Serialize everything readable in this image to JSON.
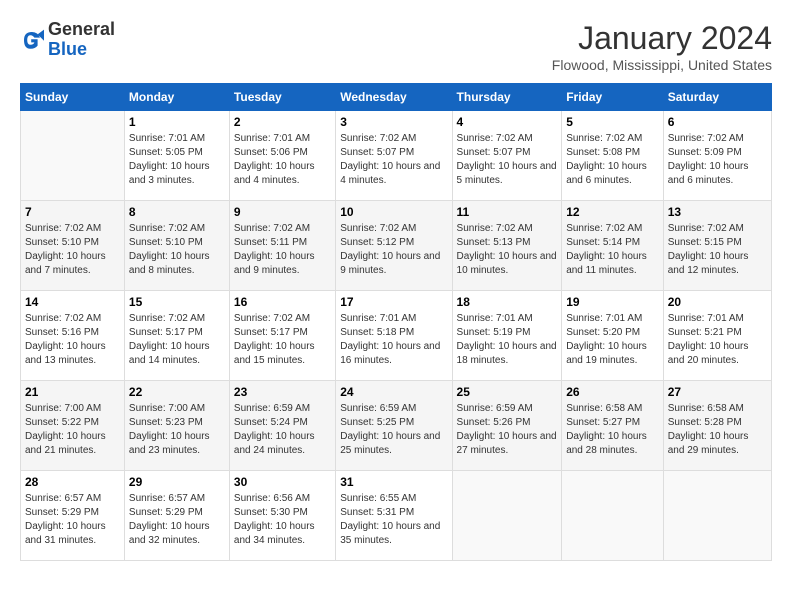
{
  "header": {
    "logo": {
      "line1": "General",
      "line2": "Blue"
    },
    "title": "January 2024",
    "location": "Flowood, Mississippi, United States"
  },
  "calendar": {
    "headers": [
      "Sunday",
      "Monday",
      "Tuesday",
      "Wednesday",
      "Thursday",
      "Friday",
      "Saturday"
    ],
    "weeks": [
      [
        {
          "day": "",
          "sunrise": "",
          "sunset": "",
          "daylight": ""
        },
        {
          "day": "1",
          "sunrise": "Sunrise: 7:01 AM",
          "sunset": "Sunset: 5:05 PM",
          "daylight": "Daylight: 10 hours and 3 minutes."
        },
        {
          "day": "2",
          "sunrise": "Sunrise: 7:01 AM",
          "sunset": "Sunset: 5:06 PM",
          "daylight": "Daylight: 10 hours and 4 minutes."
        },
        {
          "day": "3",
          "sunrise": "Sunrise: 7:02 AM",
          "sunset": "Sunset: 5:07 PM",
          "daylight": "Daylight: 10 hours and 4 minutes."
        },
        {
          "day": "4",
          "sunrise": "Sunrise: 7:02 AM",
          "sunset": "Sunset: 5:07 PM",
          "daylight": "Daylight: 10 hours and 5 minutes."
        },
        {
          "day": "5",
          "sunrise": "Sunrise: 7:02 AM",
          "sunset": "Sunset: 5:08 PM",
          "daylight": "Daylight: 10 hours and 6 minutes."
        },
        {
          "day": "6",
          "sunrise": "Sunrise: 7:02 AM",
          "sunset": "Sunset: 5:09 PM",
          "daylight": "Daylight: 10 hours and 6 minutes."
        }
      ],
      [
        {
          "day": "7",
          "sunrise": "Sunrise: 7:02 AM",
          "sunset": "Sunset: 5:10 PM",
          "daylight": "Daylight: 10 hours and 7 minutes."
        },
        {
          "day": "8",
          "sunrise": "Sunrise: 7:02 AM",
          "sunset": "Sunset: 5:10 PM",
          "daylight": "Daylight: 10 hours and 8 minutes."
        },
        {
          "day": "9",
          "sunrise": "Sunrise: 7:02 AM",
          "sunset": "Sunset: 5:11 PM",
          "daylight": "Daylight: 10 hours and 9 minutes."
        },
        {
          "day": "10",
          "sunrise": "Sunrise: 7:02 AM",
          "sunset": "Sunset: 5:12 PM",
          "daylight": "Daylight: 10 hours and 9 minutes."
        },
        {
          "day": "11",
          "sunrise": "Sunrise: 7:02 AM",
          "sunset": "Sunset: 5:13 PM",
          "daylight": "Daylight: 10 hours and 10 minutes."
        },
        {
          "day": "12",
          "sunrise": "Sunrise: 7:02 AM",
          "sunset": "Sunset: 5:14 PM",
          "daylight": "Daylight: 10 hours and 11 minutes."
        },
        {
          "day": "13",
          "sunrise": "Sunrise: 7:02 AM",
          "sunset": "Sunset: 5:15 PM",
          "daylight": "Daylight: 10 hours and 12 minutes."
        }
      ],
      [
        {
          "day": "14",
          "sunrise": "Sunrise: 7:02 AM",
          "sunset": "Sunset: 5:16 PM",
          "daylight": "Daylight: 10 hours and 13 minutes."
        },
        {
          "day": "15",
          "sunrise": "Sunrise: 7:02 AM",
          "sunset": "Sunset: 5:17 PM",
          "daylight": "Daylight: 10 hours and 14 minutes."
        },
        {
          "day": "16",
          "sunrise": "Sunrise: 7:02 AM",
          "sunset": "Sunset: 5:17 PM",
          "daylight": "Daylight: 10 hours and 15 minutes."
        },
        {
          "day": "17",
          "sunrise": "Sunrise: 7:01 AM",
          "sunset": "Sunset: 5:18 PM",
          "daylight": "Daylight: 10 hours and 16 minutes."
        },
        {
          "day": "18",
          "sunrise": "Sunrise: 7:01 AM",
          "sunset": "Sunset: 5:19 PM",
          "daylight": "Daylight: 10 hours and 18 minutes."
        },
        {
          "day": "19",
          "sunrise": "Sunrise: 7:01 AM",
          "sunset": "Sunset: 5:20 PM",
          "daylight": "Daylight: 10 hours and 19 minutes."
        },
        {
          "day": "20",
          "sunrise": "Sunrise: 7:01 AM",
          "sunset": "Sunset: 5:21 PM",
          "daylight": "Daylight: 10 hours and 20 minutes."
        }
      ],
      [
        {
          "day": "21",
          "sunrise": "Sunrise: 7:00 AM",
          "sunset": "Sunset: 5:22 PM",
          "daylight": "Daylight: 10 hours and 21 minutes."
        },
        {
          "day": "22",
          "sunrise": "Sunrise: 7:00 AM",
          "sunset": "Sunset: 5:23 PM",
          "daylight": "Daylight: 10 hours and 23 minutes."
        },
        {
          "day": "23",
          "sunrise": "Sunrise: 6:59 AM",
          "sunset": "Sunset: 5:24 PM",
          "daylight": "Daylight: 10 hours and 24 minutes."
        },
        {
          "day": "24",
          "sunrise": "Sunrise: 6:59 AM",
          "sunset": "Sunset: 5:25 PM",
          "daylight": "Daylight: 10 hours and 25 minutes."
        },
        {
          "day": "25",
          "sunrise": "Sunrise: 6:59 AM",
          "sunset": "Sunset: 5:26 PM",
          "daylight": "Daylight: 10 hours and 27 minutes."
        },
        {
          "day": "26",
          "sunrise": "Sunrise: 6:58 AM",
          "sunset": "Sunset: 5:27 PM",
          "daylight": "Daylight: 10 hours and 28 minutes."
        },
        {
          "day": "27",
          "sunrise": "Sunrise: 6:58 AM",
          "sunset": "Sunset: 5:28 PM",
          "daylight": "Daylight: 10 hours and 29 minutes."
        }
      ],
      [
        {
          "day": "28",
          "sunrise": "Sunrise: 6:57 AM",
          "sunset": "Sunset: 5:29 PM",
          "daylight": "Daylight: 10 hours and 31 minutes."
        },
        {
          "day": "29",
          "sunrise": "Sunrise: 6:57 AM",
          "sunset": "Sunset: 5:29 PM",
          "daylight": "Daylight: 10 hours and 32 minutes."
        },
        {
          "day": "30",
          "sunrise": "Sunrise: 6:56 AM",
          "sunset": "Sunset: 5:30 PM",
          "daylight": "Daylight: 10 hours and 34 minutes."
        },
        {
          "day": "31",
          "sunrise": "Sunrise: 6:55 AM",
          "sunset": "Sunset: 5:31 PM",
          "daylight": "Daylight: 10 hours and 35 minutes."
        },
        {
          "day": "",
          "sunrise": "",
          "sunset": "",
          "daylight": ""
        },
        {
          "day": "",
          "sunrise": "",
          "sunset": "",
          "daylight": ""
        },
        {
          "day": "",
          "sunrise": "",
          "sunset": "",
          "daylight": ""
        }
      ]
    ]
  }
}
